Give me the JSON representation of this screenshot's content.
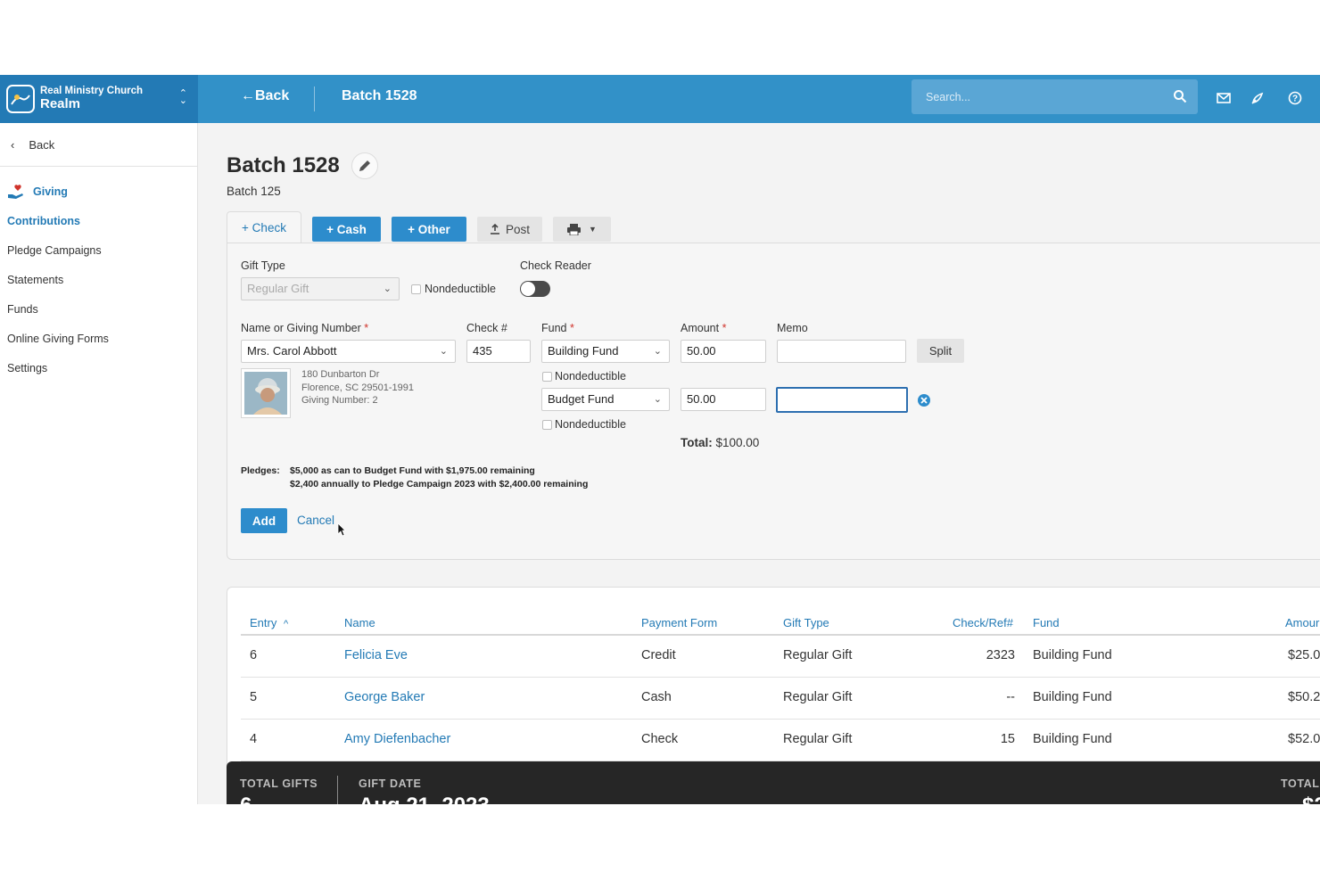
{
  "brand": {
    "org": "Real Ministry Church",
    "name": "Realm",
    "switch_icon": "chevron-up-down-icon"
  },
  "topbar": {
    "back_label": "Back",
    "title": "Batch 1528",
    "search_placeholder": "Search...",
    "icons": [
      "search-icon",
      "mail-icon",
      "rocket-icon",
      "help-icon"
    ]
  },
  "sidebar": {
    "back_label": "Back",
    "section_label": "Giving",
    "items": [
      {
        "label": "Contributions",
        "active": true
      },
      {
        "label": "Pledge Campaigns"
      },
      {
        "label": "Statements"
      },
      {
        "label": "Funds"
      },
      {
        "label": "Online Giving Forms"
      },
      {
        "label": "Settings"
      }
    ]
  },
  "page": {
    "title": "Batch 1528",
    "subtitle": "Batch 125"
  },
  "tabs": {
    "check": "+ Check",
    "cash": "+ Cash",
    "other": "+ Other",
    "post": "Post"
  },
  "form": {
    "gift_type_label": "Gift Type",
    "gift_type_value": "Regular Gift",
    "nondeductible_label": "Nondeductible",
    "check_reader_label": "Check Reader",
    "check_reader_on": false,
    "name_label": "Name or Giving Number",
    "name_value": "Mrs. Carol Abbott",
    "check_label": "Check #",
    "check_value": "435",
    "fund_label": "Fund",
    "amount_label": "Amount",
    "memo_label": "Memo",
    "lines": [
      {
        "fund": "Building Fund",
        "amount": "50.00",
        "memo": "",
        "nondeductible": "Nondeductible"
      },
      {
        "fund": "Budget Fund",
        "amount": "50.00",
        "memo": "",
        "nondeductible": "Nondeductible"
      }
    ],
    "split_label": "Split",
    "donor": {
      "address1": "180 Dunbarton Dr",
      "address2": "Florence, SC 29501-1991",
      "giving_number": "Giving Number: 2"
    },
    "total_label": "Total:",
    "total_value": "$100.00",
    "pledges_label": "Pledges:",
    "pledges": [
      "$5,000 as can to Budget Fund with $1,975.00 remaining",
      "$2,400 annually to Pledge Campaign 2023 with $2,400.00 remaining"
    ],
    "add_label": "Add",
    "cancel_label": "Cancel"
  },
  "table": {
    "columns": [
      "Entry",
      "Name",
      "Payment Form",
      "Gift Type",
      "Check/Ref#",
      "Fund",
      "Amour"
    ],
    "sort_indicator": "^",
    "rows": [
      [
        "6",
        "Felicia Eve",
        "Credit",
        "Regular Gift",
        "2323",
        "Building Fund",
        "$25.0"
      ],
      [
        "5",
        "George Baker",
        "Cash",
        "Regular Gift",
        "--",
        "Building Fund",
        "$50.2"
      ],
      [
        "4",
        "Amy Diefenbacher",
        "Check",
        "Regular Gift",
        "15",
        "Building Fund",
        "$52.0"
      ]
    ]
  },
  "footer": {
    "total_gifts_label": "TOTAL GIFTS",
    "total_gifts_value": "6",
    "gift_date_label": "GIFT DATE",
    "gift_date_value": "Aug 21, 2023",
    "total_label": "TOTAL",
    "total_value": "$2"
  },
  "colors": {
    "header": "#3291c8",
    "brand": "#237ab5",
    "accent": "#2d8ccc",
    "footer": "#262626"
  }
}
